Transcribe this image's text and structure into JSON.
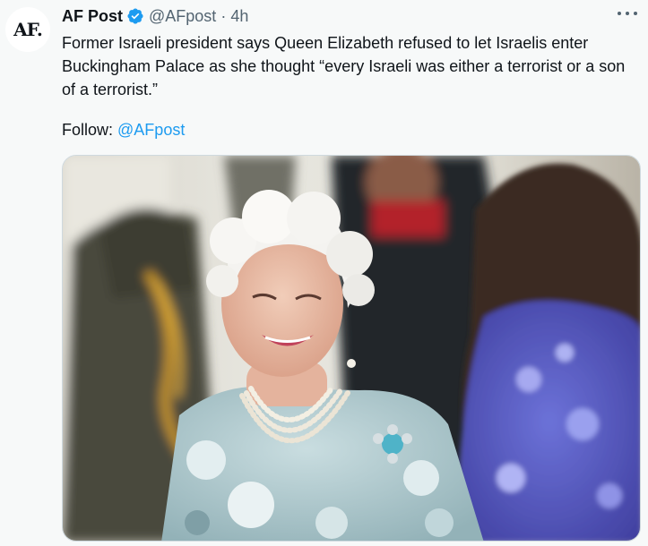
{
  "author": {
    "avatar_text": "AF.",
    "name": "AF Post",
    "handle": "@AFpost",
    "separator": "·",
    "time": "4h",
    "verified_icon": "verified-badge-icon",
    "accent_color": "#1d9bf0"
  },
  "tweet": {
    "text": "Former Israeli president says Queen Elizabeth refused to let Israelis enter Buckingham Palace as she thought “every Israeli was either a terrorist or a son of a terrorist.”",
    "follow_label": "Follow:",
    "follow_mention": "@AFpost"
  },
  "menu": {
    "icon": "more-horizontal-icon"
  },
  "media": {
    "icon": "photo-image"
  }
}
